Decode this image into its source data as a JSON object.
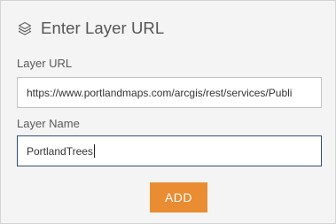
{
  "panel": {
    "title": "Enter Layer URL",
    "title_icon": "layers-icon"
  },
  "fields": {
    "url": {
      "label": "Layer URL",
      "value": "https://www.portlandmaps.com/arcgis/rest/services/Publi"
    },
    "name": {
      "label": "Layer Name",
      "value": "PortlandTrees"
    }
  },
  "actions": {
    "add_label": "ADD"
  },
  "colors": {
    "accent": "#ea8c32",
    "focus_border": "#2b4f7a",
    "panel_bg": "#f4f4f4"
  }
}
